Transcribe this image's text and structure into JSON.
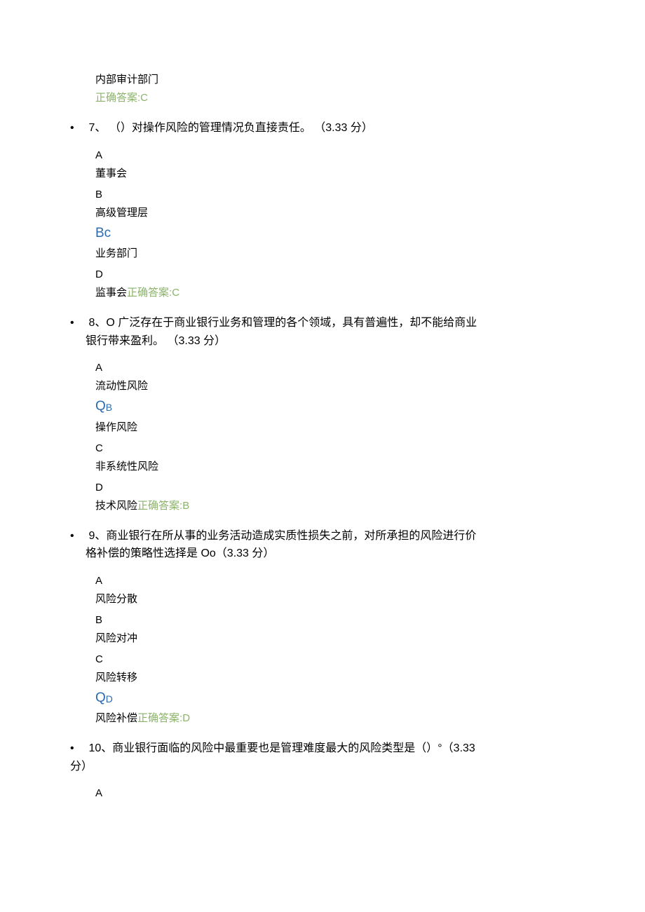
{
  "q6_tail": {
    "opt_d_text": "内部审计部门",
    "answer_label": "正确答案:",
    "answer_value": "C"
  },
  "q7": {
    "bullet": "•",
    "number": "7、",
    "stem_a": "（）对操作风险的管理情况负直接责任。",
    "points": "（3.33 分）",
    "opts": {
      "A_letter": "A",
      "A_text": "董事会",
      "B_letter": "B",
      "B_text": "高级管理层",
      "marker": "Bc",
      "C_text": "业务部门",
      "D_letter": "D",
      "D_text_prefix": "监事会",
      "answer_label": "正确答案:",
      "answer_value": "C"
    }
  },
  "q8": {
    "bullet": "•",
    "number": "8、",
    "stem_line1": "O 广泛存在于商业银行业务和管理的各个领域，具有普遍性，却不能给商业",
    "stem_line2": "银行带来盈利。",
    "points": "（3.33 分）",
    "opts": {
      "A_letter": "A",
      "A_text": "流动性风险",
      "marker_main": "Q",
      "marker_sub": "B",
      "B_text": "操作风险",
      "C_letter": "C",
      "C_text": "非系统性风险",
      "D_letter": "D",
      "D_text_prefix": "技术风险",
      "answer_label": "正确答案:",
      "answer_value": "B"
    }
  },
  "q9": {
    "bullet": "•",
    "number": "9、",
    "stem_line1": "商业银行在所从事的业务活动造成实质性损失之前，对所承担的风险进行价",
    "stem_line2": "格补偿的策略性选择是 Oo",
    "points": "（3.33 分）",
    "opts": {
      "A_letter": "A",
      "A_text": "风险分散",
      "B_letter": "B",
      "B_text": "风险对冲",
      "C_letter": "C",
      "C_text": "风险转移",
      "marker_main": "Q",
      "marker_sub": "D",
      "D_text_prefix": "风险补偿",
      "answer_label": "正确答案:",
      "answer_value": "D"
    }
  },
  "q10": {
    "bullet": "•",
    "number": "10、",
    "stem_a": "商业银行面临的风险中最重要也是管理难度最大的风险类型是（）°",
    "points_a": "（3.33",
    "points_b": "分）",
    "opts": {
      "A_letter": "A"
    }
  }
}
